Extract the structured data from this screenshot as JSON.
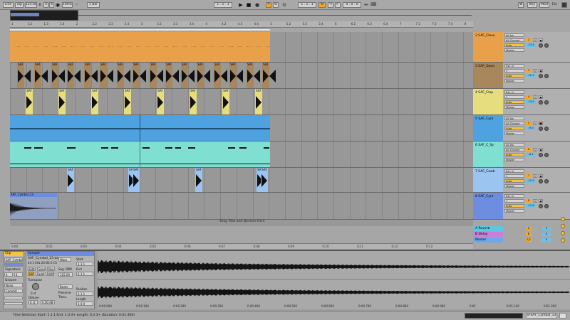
{
  "colors": {
    "accent": "#f5a623",
    "ruler": "#b3b3b3",
    "track_orange": "#e8a14a",
    "track_brown": "#a8875c",
    "track_yellow": "#e6de7e",
    "track_blue": "#4ea2e0",
    "track_cyan": "#7fe0d2",
    "track_lightblue": "#9cc4f0",
    "track_indigo": "#6d8ee0",
    "return_a": "#5fc6de",
    "return_b": "#c77fdb",
    "master": "#6fa7e8",
    "waveform": "#141414"
  },
  "topbar": {
    "link": "Link",
    "tap": "Tap",
    "tempo": "125.00",
    "sig_num": "4",
    "sig_den": "4",
    "zoom": "100%",
    "metronome": "1 Bar",
    "position": "1 . 1 . 1",
    "position2": "1 . 1 . 1",
    "loop_len": "4 . 0 . 0",
    "key": "Key",
    "midi": "MIDI",
    "cpu": "1%"
  },
  "ruler": {
    "ticks": [
      "1",
      "1.2",
      "1.3",
      "1.4",
      "2",
      "2.2",
      "2.3",
      "2.4",
      "3",
      "3.2",
      "3.3",
      "3.4",
      "4",
      "4.2",
      "4.3",
      "4.4",
      "5",
      "5.2",
      "5.3",
      "5.4",
      "6",
      "6.2",
      "6.3",
      "6.4",
      "7",
      "7.2",
      "7.3",
      "7.4",
      "8"
    ]
  },
  "timebar": {
    "ticks": [
      "0:00",
      "0:02",
      "0:03",
      "0:04",
      "0:05",
      "0:06",
      "0:07",
      "0:08",
      "0:09",
      "0:10",
      "0:11",
      "0:12",
      "0:13"
    ]
  },
  "tracks": [
    {
      "name": "2 SAF_Close",
      "input": "All Ins",
      "channel": "All Channe",
      "monitor": "Auto",
      "output": "Master",
      "num": "2",
      "vol": "-13.4",
      "color": "#e8a14a",
      "label": "SAF"
    },
    {
      "name": "3 SAF_Open",
      "input": "Ext. In",
      "channel": "1",
      "monitor": "Auto",
      "output": "Master",
      "num": "3",
      "vol": "-10.1",
      "color": "#a8875c",
      "label": "SAF"
    },
    {
      "name": "4 SAF_Clap",
      "input": "Ext. In",
      "channel": "1",
      "monitor": "Auto",
      "output": "Master",
      "num": "4",
      "vol": "-13.0",
      "color": "#e6de7e",
      "label": "SAF"
    },
    {
      "name": "5 SAF_Cym",
      "input": "All Ins",
      "channel": "All Channe",
      "monitor": "Auto",
      "output": "Master",
      "num": "5",
      "vol": "-9.0",
      "color": "#4ea2e0",
      "label": ""
    },
    {
      "name": "6 SAF_C_Sy",
      "input": "All Ins",
      "channel": "All Channe",
      "monitor": "Auto",
      "output": "Master",
      "num": "6",
      "vol": "-8.1",
      "color": "#7fe0d2",
      "label": ""
    },
    {
      "name": "7 SAF_Cowb",
      "input": "Ext. In",
      "channel": "1",
      "monitor": "Auto",
      "output": "Master",
      "num": "7",
      "vol": "-10.5",
      "color": "#9cc4f0",
      "label": "SAF"
    },
    {
      "name": "8 SAF_Cym",
      "input": "Ext. In",
      "channel": "1",
      "monitor": "Auto",
      "output": "Master",
      "num": "8",
      "vol": "-12.8",
      "color": "#6d8ee0",
      "label": "SAF_Cymbal_13"
    }
  ],
  "drop_text": "Drop Files and Devices Here",
  "returns": [
    {
      "name": "A Reverb",
      "num": "A",
      "vol": "0"
    },
    {
      "name": "B Delay",
      "num": "B",
      "vol": "0"
    },
    {
      "name": "Master",
      "num": "1/2",
      "vol": "0"
    }
  ],
  "clip_panel": {
    "title": "Clip",
    "name": "SAF_Cymbal",
    "signature_label": "Signature",
    "sig_num": "4",
    "sig_den": "4",
    "groove_label": "Groove",
    "groove_value": "None",
    "commit_label": "Commit"
  },
  "sample_panel": {
    "title": "Sample",
    "file": "SAF_Cymbal_13.wa",
    "info": "44.1 kHz 24 Bit 0 Ch",
    "edit": "Edit",
    "save": "Save",
    "rev": "Rev",
    "hiq": "HiQ",
    "fade": "Fade",
    "ram": "RAM",
    "warp": "Warp",
    "seg_bpm_label": "Seg. BPM",
    "seg_bpm": "125.00",
    "transpose_label": "Transpose",
    "transpose": "0 st",
    "detune_label": "Detune",
    "detune": "0 ct",
    "gain": "0.00 dB",
    "beats": "Beats",
    "preserve_label": "Preserve",
    "trans_label": "Trans.",
    "start_label": "Start",
    "end_label": "End",
    "position_label": "Position",
    "length_label": "Length",
    "start_val": "1 1 1",
    "end_val": "2 1 1",
    "pos_val": "1 1 1",
    "len_val": "1 0 0"
  },
  "waveview": {
    "ticks": [
      "0:00.000",
      "0:00.100",
      "0:00.200",
      "0:00.300",
      "0:00.400",
      "0:00.500",
      "0:00.600",
      "0:00.700",
      "0:00.800",
      "0:00.900",
      "0:01",
      "0:01.100",
      "0:01.200"
    ]
  },
  "status": {
    "text": "Time Selection  Start: 1.1.1  End: 1.3.4+  Length: 0.2.3+  (Duration: 0:01.400)",
    "clip_name": "8-SAF_Cymbal_13"
  }
}
